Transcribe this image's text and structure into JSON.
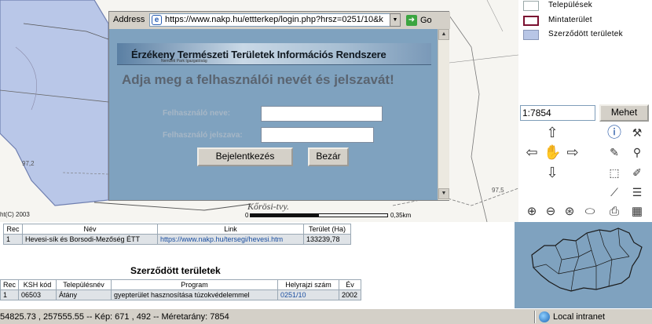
{
  "map": {
    "copyright": "ht(C) 2003",
    "place_name": "Kőrösi-tvy.",
    "scale_start": "0",
    "scale_end": "0,35km",
    "spot_heights": [
      "97,2",
      "97,5"
    ]
  },
  "popup": {
    "address_label": "Address",
    "url": "https://www.nakp.hu/ettterkep/login.php?hrsz=0251/10&k",
    "go_label": "Go",
    "banner_title": "Érzékeny Természeti Területek Információs Rendszere",
    "banner_small": "Nemzeti Park Igazgatóság",
    "heading": "Adja meg a felhasználói nevét és jelszavát!",
    "username_label": "Felhasználó neve:",
    "username_value": "",
    "password_label": "Felhasználó jelszava:",
    "password_value": "",
    "login_button": "Bejelentkezés",
    "close_button": "Bezár"
  },
  "legend": {
    "items": [
      {
        "label": "Települések",
        "fill": "#ffffff",
        "border": "#9aa8a8"
      },
      {
        "label": "Mintaterület",
        "fill": "#ffffff",
        "border": "#7a1030"
      },
      {
        "label": "Szerződött területek",
        "fill": "#b8c6e6",
        "border": "#8896b8"
      }
    ]
  },
  "tools": {
    "scale_prefix": "1:",
    "scale_value": "7854",
    "go_button": "Mehet",
    "icons": [
      "pan-up-icon",
      "info-icon",
      "pan-left-icon",
      "hand-pan-icon",
      "pan-right-icon",
      "measure-icon",
      "pan-down-icon",
      "select-icon",
      "zoom-in-icon",
      "zoom-out-icon",
      "print-icon"
    ]
  },
  "info_table": {
    "headers": [
      "Rec",
      "Név",
      "Link",
      "Terület (Ha)"
    ],
    "rows": [
      [
        "1",
        "Hevesi-sík és Borsodi-Mezőség ÉTT",
        "https://www.nakp.hu/tersegi/hevesi.htm",
        "133239,78"
      ]
    ]
  },
  "contract_section": {
    "title": "Szerződött területek",
    "headers": [
      "Rec",
      "KSH kód",
      "Településnév",
      "Program",
      "Helyrajzi szám",
      "Év"
    ],
    "rows": [
      [
        "1",
        "06503",
        "Átány",
        "gyepterület hasznosítása túzokvédelemmel",
        "0251/10",
        "2002"
      ]
    ]
  },
  "status": {
    "text": "54825.73 , 257555.55 -- Kép: 671 , 492 -- Méretarány: 7854",
    "zone": "Local intranet"
  }
}
